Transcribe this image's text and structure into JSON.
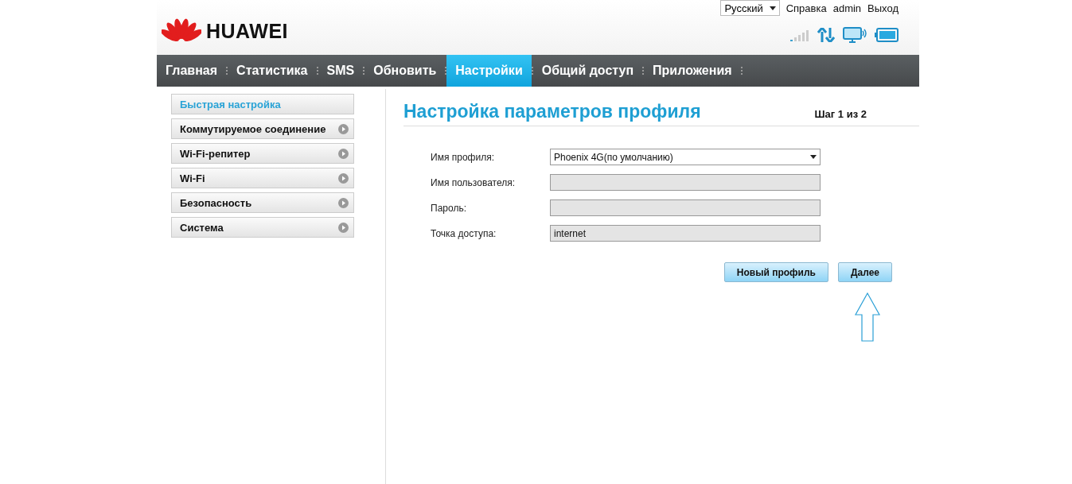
{
  "header": {
    "logo_text": "HUAWEI",
    "language": "Русский",
    "links": [
      "Справка",
      "admin",
      "Выход"
    ]
  },
  "nav": [
    {
      "label": "Главная",
      "selected": false
    },
    {
      "label": "Статистика",
      "selected": false
    },
    {
      "label": "SMS",
      "selected": false
    },
    {
      "label": "Обновить",
      "selected": false
    },
    {
      "label": "Настройки",
      "selected": true
    },
    {
      "label": "Общий доступ",
      "selected": false
    },
    {
      "label": "Приложения",
      "selected": false
    }
  ],
  "sidebar": {
    "items": [
      {
        "label": "Быстрая настройка",
        "selected": true
      },
      {
        "label": "Коммутируемое соединение",
        "selected": false
      },
      {
        "label": "Wi-Fi-репитер",
        "selected": false
      },
      {
        "label": "Wi-Fi",
        "selected": false
      },
      {
        "label": "Безопасность",
        "selected": false
      },
      {
        "label": "Система",
        "selected": false
      }
    ]
  },
  "main": {
    "title": "Настройка параметров профиля",
    "step": "Шаг 1 из 2",
    "fields": [
      {
        "label": "Имя профиля:",
        "kind": "select",
        "value": "Phoenix 4G(по умолчанию)",
        "disabled": false
      },
      {
        "label": "Имя пользователя:",
        "kind": "text",
        "disabled": true
      },
      {
        "label": "Пароль:",
        "kind": "text",
        "disabled": true
      },
      {
        "label": "Точка доступа:",
        "kind": "text",
        "value": "internet",
        "disabled": true
      }
    ],
    "buttons": [
      "Новый профиль",
      "Далее"
    ]
  }
}
